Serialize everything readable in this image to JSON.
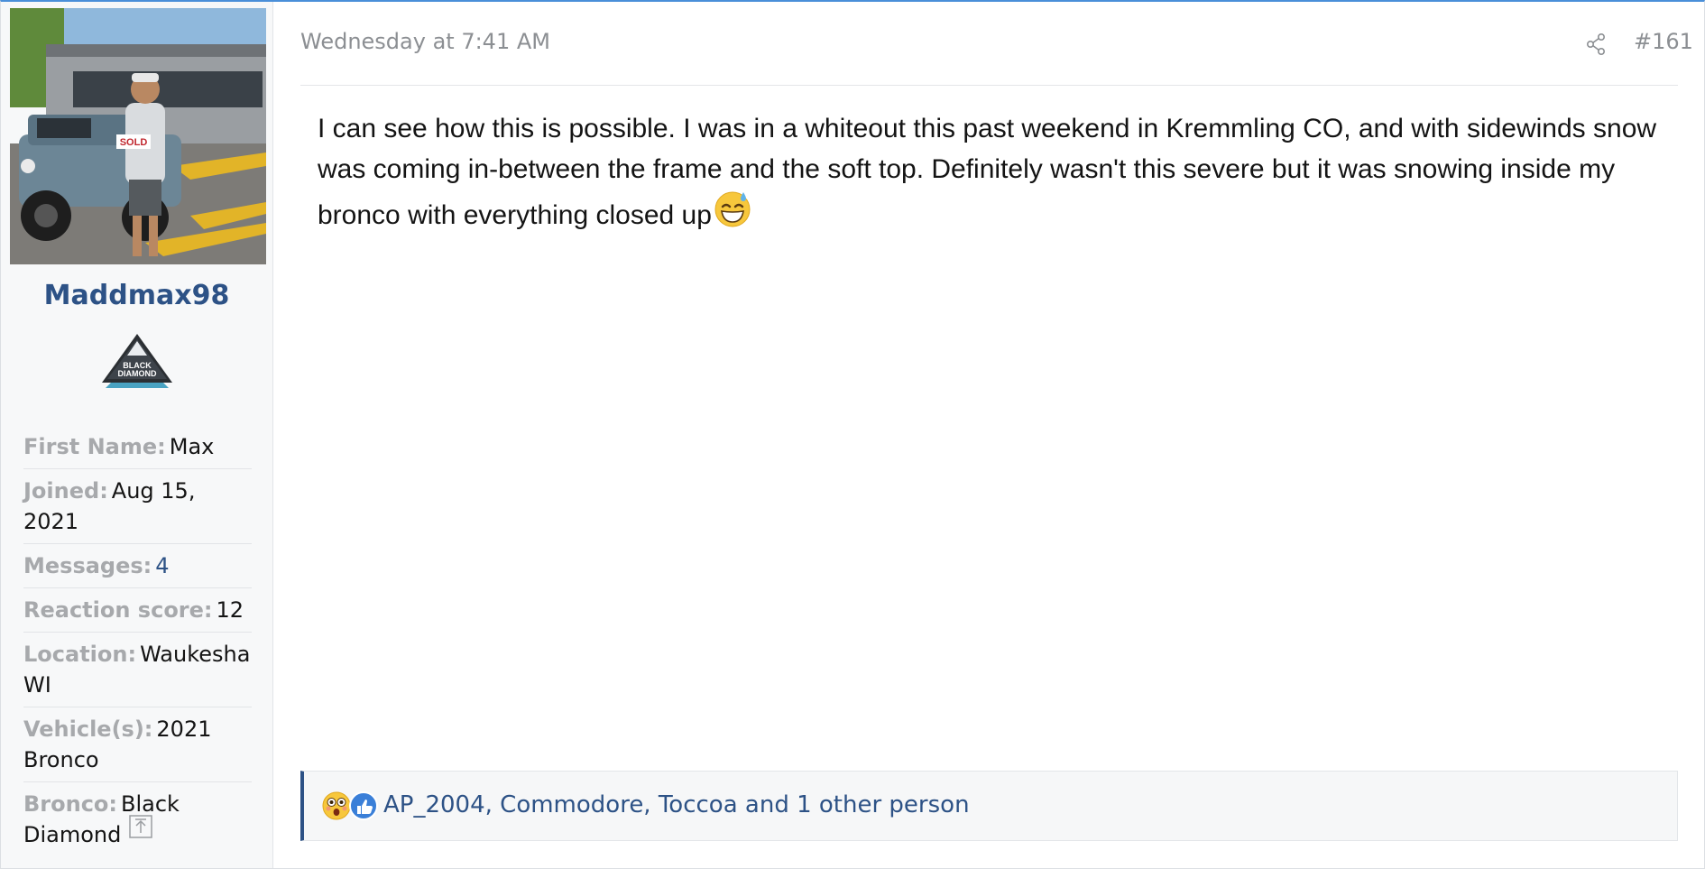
{
  "user": {
    "username": "Maddmax98",
    "fields": [
      {
        "label": "First Name:",
        "value": "Max"
      },
      {
        "label": "Joined:",
        "value": "Aug 15, 2021"
      },
      {
        "label": "Messages:",
        "value": "4"
      },
      {
        "label": "Reaction score:",
        "value": "12"
      },
      {
        "label": "Location:",
        "value": "Waukesha WI"
      },
      {
        "label": "Vehicle(s):",
        "value": "2021 Bronco"
      },
      {
        "label": "Bronco:",
        "value": "Black Diamond"
      }
    ],
    "badge_text": [
      "BLACK",
      "DIAMOND"
    ],
    "avatar_sign_text": "SOLD"
  },
  "post": {
    "time": "Wednesday at 7:41 AM",
    "number": "#161",
    "body": "I can see how this is possible. I was in a whiteout this past weekend in Kremmling CO, and with sidewinds snow was coming in-between the frame and the soft top. Definitely wasn't this severe but it was snowing inside my bronco with everything closed up",
    "emoji_icon": "grinning-sweat-emoji"
  },
  "reactions": {
    "icons": [
      "flushed-face-icon",
      "thumbs-up-icon"
    ],
    "text": "AP_2004, Commodore, Toccoa and 1 other person"
  },
  "colors": {
    "accent": "#2d5286",
    "top_border": "#4a8fd9",
    "muted": "#8c8f93"
  }
}
